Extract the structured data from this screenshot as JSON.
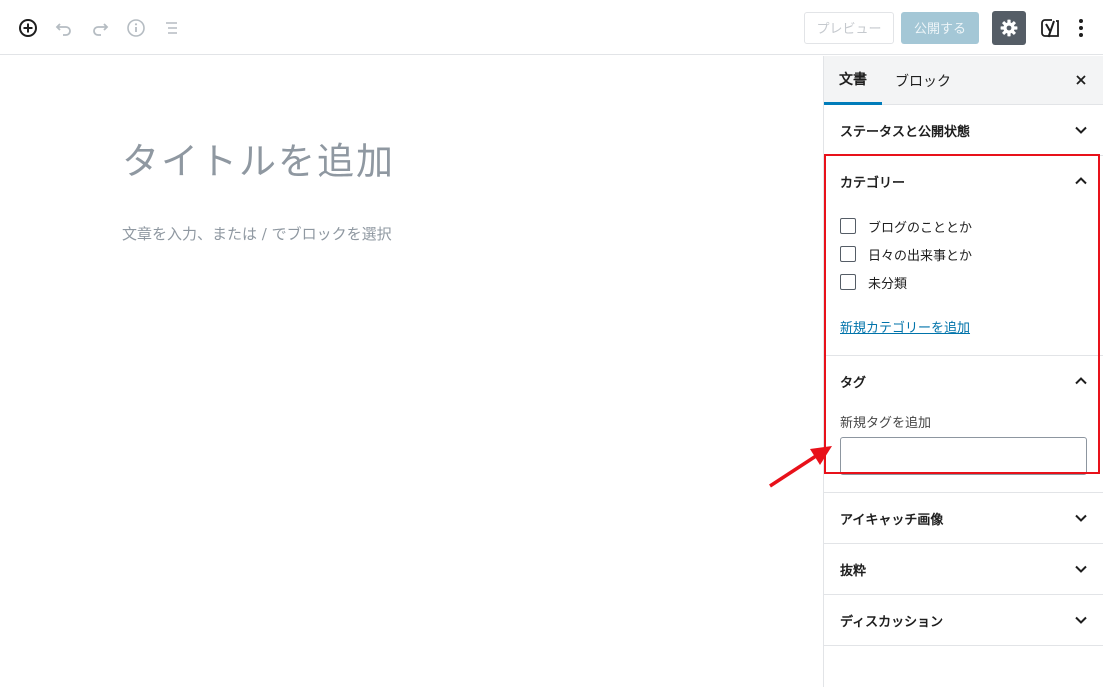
{
  "toolbar": {
    "icons": [
      "add-block-icon",
      "undo-icon",
      "redo-icon",
      "info-icon",
      "list-view-icon"
    ],
    "preview_label": "プレビュー",
    "publish_label": "公開する",
    "settings_icon": "gear-icon",
    "yoast_label": "y",
    "more_icon": "more-vertical-icon"
  },
  "editor": {
    "title_placeholder": "タイトルを追加",
    "body_placeholder": "文章を入力、または / でブロックを選択"
  },
  "sidebar": {
    "tabs": [
      {
        "label": "文書",
        "active": true
      },
      {
        "label": "ブロック",
        "active": false
      }
    ],
    "panels": {
      "status": {
        "title": "ステータスと公開状態"
      },
      "category": {
        "title": "カテゴリー",
        "items": [
          "ブログのこととか",
          "日々の出来事とか",
          "未分類"
        ],
        "add_link": "新規カテゴリーを追加"
      },
      "tags": {
        "title": "タグ",
        "input_label": "新規タグを追加",
        "input_value": ""
      },
      "featured_image": {
        "title": "アイキャッチ画像"
      },
      "excerpt": {
        "title": "抜粋"
      },
      "discussion": {
        "title": "ディスカッション"
      }
    }
  },
  "colors": {
    "accent": "#007cba",
    "highlight": "#e8111a",
    "publish_disabled": "#a4c7d6",
    "settings_bg": "#555d66"
  }
}
